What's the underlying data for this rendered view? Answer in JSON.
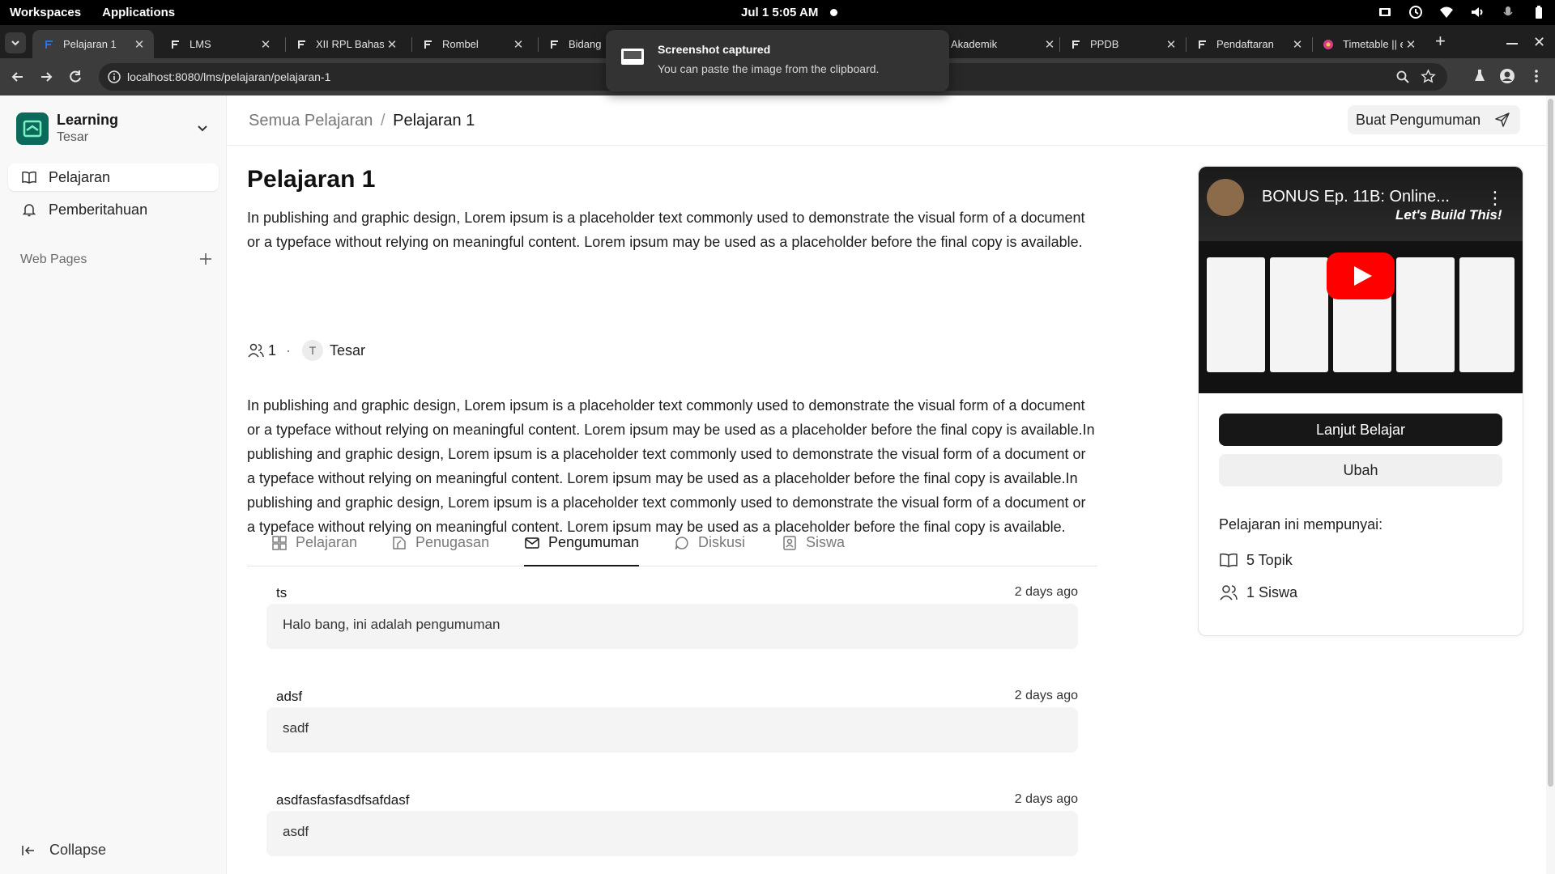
{
  "system_bar": {
    "workspaces": "Workspaces",
    "applications": "Applications",
    "clock": "Jul 1  5:05 AM"
  },
  "browser": {
    "tabs": [
      {
        "title": "Pelajaran 1",
        "active": true
      },
      {
        "title": "LMS"
      },
      {
        "title": "XII RPL Bahasa"
      },
      {
        "title": "Rombel"
      },
      {
        "title": "Bidang"
      },
      {
        "title": "Akademik"
      },
      {
        "title": "PPDB"
      },
      {
        "title": "Pendaftaran"
      },
      {
        "title": "Timetable || e"
      }
    ],
    "url": "localhost:8080/lms/pelajaran/pelajaran-1"
  },
  "notification": {
    "title": "Screenshot captured",
    "body": "You can paste the image from the clipboard."
  },
  "sidebar": {
    "brand_name": "Learning",
    "brand_user": "Tesar",
    "items": [
      {
        "label": "Pelajaran",
        "icon": "book-open-icon",
        "active": true
      },
      {
        "label": "Pemberitahuan",
        "icon": "bell-icon"
      }
    ],
    "web_pages_label": "Web Pages",
    "collapse_label": "Collapse"
  },
  "header": {
    "breadcrumb_root": "Semua Pelajaran",
    "breadcrumb_sep": "/",
    "breadcrumb_current": "Pelajaran 1",
    "announce_button": "Buat Pengumuman"
  },
  "course": {
    "title": "Pelajaran 1",
    "short_description": "In publishing and graphic design, Lorem ipsum is a placeholder text commonly used to demonstrate the visual form of a document or a typeface without relying on meaningful content. Lorem ipsum may be used as a placeholder before the final copy is available.",
    "student_count": "1",
    "meta_dot": "·",
    "instructor_initial": "T",
    "instructor_name": "Tesar",
    "long_description": "In publishing and graphic design, Lorem ipsum is a placeholder text commonly used to demonstrate the visual form of a document or a typeface without relying on meaningful content. Lorem ipsum may be used as a placeholder before the final copy is available.In publishing and graphic design, Lorem ipsum is a placeholder text commonly used to demonstrate the visual form of a document or a typeface without relying on meaningful content. Lorem ipsum may be used as a placeholder before the final copy is available.In publishing and graphic design, Lorem ipsum is a placeholder text commonly used to demonstrate the visual form of a document or a typeface without relying on meaningful content. Lorem ipsum may be used as a placeholder before the final copy is available."
  },
  "content_tabs": [
    {
      "label": "Pelajaran",
      "icon": "grid-icon"
    },
    {
      "label": "Penugasan",
      "icon": "assignment-icon"
    },
    {
      "label": "Pengumuman",
      "icon": "mail-icon",
      "active": true
    },
    {
      "label": "Diskusi",
      "icon": "chat-icon"
    },
    {
      "label": "Siswa",
      "icon": "student-icon"
    }
  ],
  "announcements": [
    {
      "title": "ts",
      "time": "2 days ago",
      "body": "Halo bang, ini adalah pengumuman"
    },
    {
      "title": "adsf",
      "time": "2 days ago",
      "body": "sadf"
    },
    {
      "title": "asdfasfasfasdfsafdasf",
      "time": "2 days ago",
      "body": "asdf"
    }
  ],
  "card": {
    "video_title": "BONUS Ep. 11B: Online...",
    "video_overlay": "Let's Build This!",
    "continue_button": "Lanjut Belajar",
    "edit_button": "Ubah",
    "has_title": "Pelajaran ini mempunyai:",
    "topics": "5 Topik",
    "students": "1 Siswa"
  },
  "colors": {
    "brand": "#0b6a5a",
    "primary_button": "#171717",
    "youtube_red": "#ff0000"
  }
}
